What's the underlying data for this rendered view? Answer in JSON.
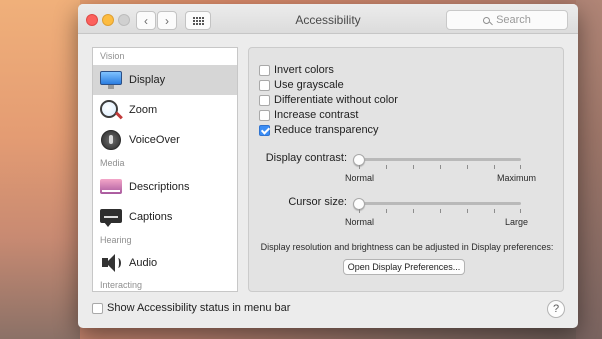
{
  "window": {
    "title": "Accessibility",
    "search_placeholder": "Search",
    "back_glyph": "‹",
    "forward_glyph": "›"
  },
  "sidebar": {
    "sections": [
      {
        "label": "Vision"
      },
      {
        "label": "Media"
      },
      {
        "label": "Hearing"
      },
      {
        "label": "Interacting"
      }
    ],
    "items": [
      {
        "label": "Display",
        "icon": "display-icon",
        "selected": true
      },
      {
        "label": "Zoom",
        "icon": "zoom-icon",
        "selected": false
      },
      {
        "label": "VoiceOver",
        "icon": "voiceover-icon",
        "selected": false
      },
      {
        "label": "Descriptions",
        "icon": "descriptions-icon",
        "selected": false
      },
      {
        "label": "Captions",
        "icon": "captions-icon",
        "selected": false
      },
      {
        "label": "Audio",
        "icon": "audio-icon",
        "selected": false
      }
    ]
  },
  "options": [
    {
      "label": "Invert colors",
      "checked": false
    },
    {
      "label": "Use grayscale",
      "checked": false
    },
    {
      "label": "Differentiate without color",
      "checked": false
    },
    {
      "label": "Increase contrast",
      "checked": false
    },
    {
      "label": "Reduce transparency",
      "checked": true
    }
  ],
  "sliders": {
    "contrast": {
      "label": "Display contrast:",
      "min_label": "Normal",
      "max_label": "Maximum",
      "value": 0
    },
    "cursor": {
      "label": "Cursor size:",
      "min_label": "Normal",
      "max_label": "Large",
      "value": 0
    }
  },
  "info_text": "Display resolution and brightness can be adjusted in Display preferences:",
  "open_display_button": "Open Display Preferences...",
  "status_checkbox": {
    "label": "Show Accessibility status in menu bar",
    "checked": false
  },
  "help_glyph": "?",
  "colors": {
    "accent": "#3b8df5",
    "selected_row": "#d6d6d6"
  }
}
